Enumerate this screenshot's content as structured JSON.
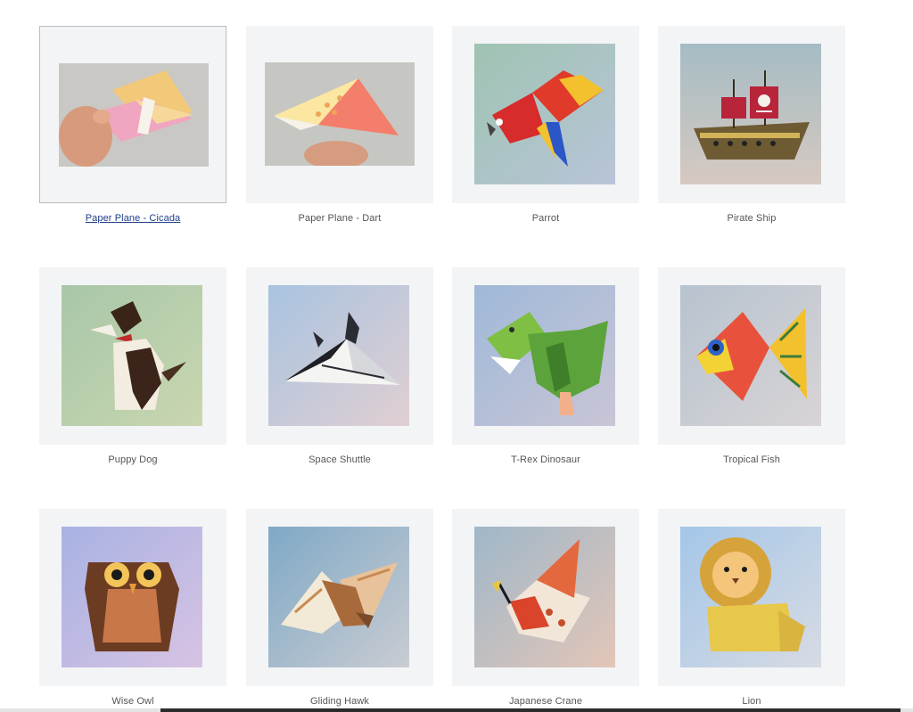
{
  "gallery": {
    "items": [
      {
        "label": "Paper Plane - Cicada",
        "icon": "paper-plane-cicada-image",
        "selected": true
      },
      {
        "label": "Paper Plane - Dart",
        "icon": "paper-plane-dart-image"
      },
      {
        "label": "Parrot",
        "icon": "parrot-image"
      },
      {
        "label": "Pirate Ship",
        "icon": "pirate-ship-image"
      },
      {
        "label": "Puppy Dog",
        "icon": "puppy-dog-image"
      },
      {
        "label": "Space Shuttle",
        "icon": "space-shuttle-image"
      },
      {
        "label": "T-Rex Dinosaur",
        "icon": "t-rex-dinosaur-image"
      },
      {
        "label": "Tropical Fish",
        "icon": "tropical-fish-image"
      },
      {
        "label": "Wise Owl",
        "icon": "wise-owl-image"
      },
      {
        "label": "Gliding Hawk",
        "icon": "gliding-hawk-image"
      },
      {
        "label": "Japanese Crane",
        "icon": "japanese-crane-image"
      },
      {
        "label": "Lion",
        "icon": "lion-image"
      }
    ]
  },
  "colors": {
    "tile_background": "#f3f4f6",
    "caption_text": "#555555",
    "link_text": "#1f3e8a"
  }
}
